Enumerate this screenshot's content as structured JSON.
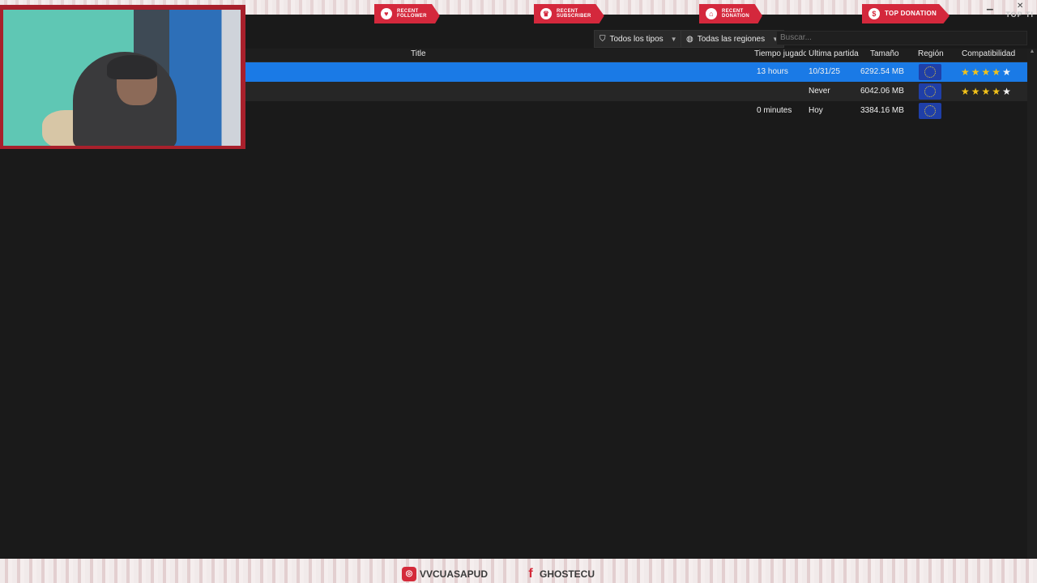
{
  "overlay": {
    "alerts": [
      {
        "line1": "RECENT",
        "line2": "FOLLOWER",
        "icon": "heart-icon"
      },
      {
        "line1": "RECENT",
        "line2": "SUBSCRIBER",
        "icon": "trophy-icon"
      },
      {
        "line1": "RECENT",
        "line2": "DONATION",
        "icon": "piggy-bank-icon"
      },
      {
        "line1": "TOP DONATION",
        "icon": "money-bag-icon"
      }
    ],
    "top_right": "TOP TI",
    "social": {
      "instagram": "VVCUASAPUD",
      "facebook": "GHOSTECU"
    }
  },
  "toolbar": {
    "type_filter": "Todos los tipos",
    "region_filter": "Todas las regiones",
    "search_placeholder": "Buscar..."
  },
  "table": {
    "columns": {
      "title": "Title",
      "playtime": "Tiempo jugado",
      "last_played": "Última partida",
      "size": "Tamaño",
      "region": "Región",
      "compat": "Compatibilidad"
    },
    "rows": [
      {
        "playtime": "13 hours",
        "last_played": "10/31/25",
        "size": "6292.54 MB",
        "region": "EU",
        "stars": 5,
        "filled": 4
      },
      {
        "playtime": "",
        "last_played": "Never",
        "size": "6042.06 MB",
        "region": "EU",
        "stars": 5,
        "filled": 4
      },
      {
        "playtime": "0 minutes",
        "last_played": "Hoy",
        "size": "3384.16 MB",
        "region": "EU",
        "stars": 0,
        "filled": 0
      }
    ]
  },
  "colors": {
    "selection": "#1a7ae6",
    "overlay_red": "#d4283c",
    "star": "#f2c21a"
  }
}
